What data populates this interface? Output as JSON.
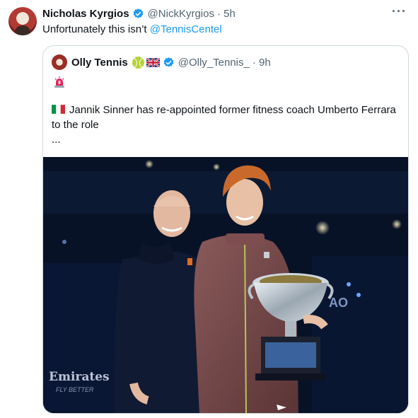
{
  "tweet": {
    "author_name": "Nicholas Kyrgios",
    "author_handle": "@NickKyrgios",
    "time": "· 5h",
    "text": "Unfortunately this isn’t ",
    "mention": "@TennisCentel",
    "more_label": "···"
  },
  "quoted": {
    "author_name": "Olly Tennis",
    "author_handle": "@Olly_Tennis_",
    "time": "· 9h",
    "text": "Jannik Sinner has re-appointed former fitness coach Umberto Ferrara to the role",
    "ellipsis": "...",
    "photo_sign": "Emirates",
    "photo_sign_sub": "FLY BETTER",
    "photo_board": "AO"
  },
  "icons": [
    "verified-icon",
    "tennis-ball-icon",
    "uk-flag-icon",
    "italy-flag-icon",
    "siren-icon",
    "more-icon"
  ],
  "colors": {
    "link": "#1d9bf0",
    "verified": "#1d9bf0",
    "muted": "#536471",
    "border": "#cfd9de"
  }
}
